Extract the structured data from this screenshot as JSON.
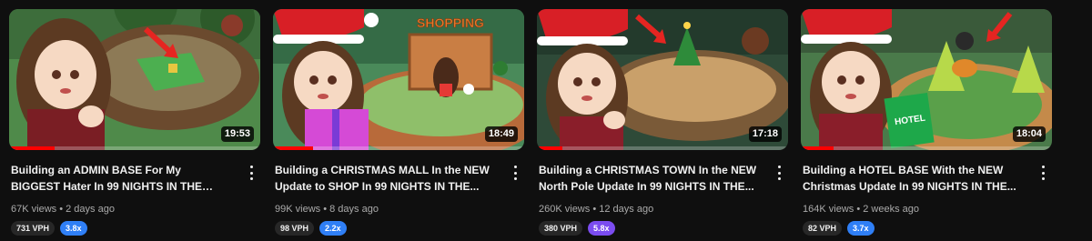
{
  "videos": [
    {
      "title": "Building an ADMIN BASE For My BIGGEST Hater In 99 NIGHTS IN THE FOREST!...",
      "duration": "19:53",
      "views": "67K views",
      "age": "2 days ago",
      "vph": "731 VPH",
      "multiplier": "3.8x",
      "multiplier_color": "#2f7ff6",
      "watched_fraction": 0.18
    },
    {
      "title": "Building a CHRISTMAS MALL In the NEW Update to SHOP In 99 NIGHTS IN THE...",
      "duration": "18:49",
      "views": "99K views",
      "age": "8 days ago",
      "vph": "98 VPH",
      "multiplier": "2.2x",
      "multiplier_color": "#2f7ff6",
      "watched_fraction": 0.16,
      "thumb_text": "SHOPPING"
    },
    {
      "title": "Building a CHRISTMAS TOWN In the NEW North Pole Update In 99 NIGHTS IN THE...",
      "duration": "17:18",
      "views": "260K views",
      "age": "12 days ago",
      "vph": "380 VPH",
      "multiplier": "5.8x",
      "multiplier_color": "#7b4cf0",
      "watched_fraction": 0.1
    },
    {
      "title": "Building a HOTEL BASE With the NEW Christmas Update In 99 NIGHTS IN THE...",
      "duration": "18:04",
      "views": "164K views",
      "age": "2 weeks ago",
      "vph": "82 VPH",
      "multiplier": "3.7x",
      "multiplier_color": "#2f7ff6",
      "watched_fraction": 0.13,
      "thumb_text": "HOTEL"
    }
  ],
  "meta_separator": "•"
}
